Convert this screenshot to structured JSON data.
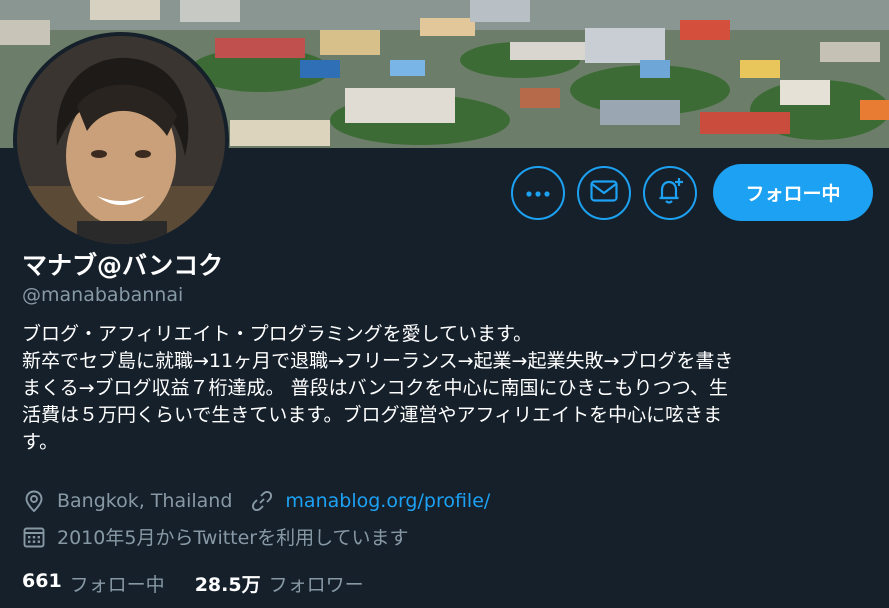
{
  "profile": {
    "name": "マナブ@バンコク",
    "handle": "@manababannai",
    "bio_lines": [
      "ブログ・アフィリエイト・プログラミングを愛しています。",
      "新卒でセブ島に就職→11ヶ月で退職→フリーランス→起業→起業失敗→ブログを書き",
      "まくる→ブログ収益７桁達成。 普段はバンコクを中心に南国にひきこもりつつ、生",
      "活費は５万円くらいで生きています。ブログ運営やアフィリエイトを中心に呟きま",
      "す。"
    ],
    "location": "Bangkok, Thailand",
    "website": "manablog.org/profile/",
    "joined": "2010年5月からTwitterを利用しています",
    "following_count": "661",
    "following_label": "フォロー中",
    "followers_count": "28.5万",
    "followers_label": "フォロワー"
  },
  "actions": {
    "more_icon": "more-horizontal-icon",
    "message_icon": "envelope-icon",
    "notify_icon": "bell-plus-icon",
    "follow_label": "フォロー中"
  },
  "colors": {
    "background": "#15202b",
    "accent": "#1da1f2",
    "secondary_text": "#8899a6",
    "primary_text": "#ffffff"
  }
}
